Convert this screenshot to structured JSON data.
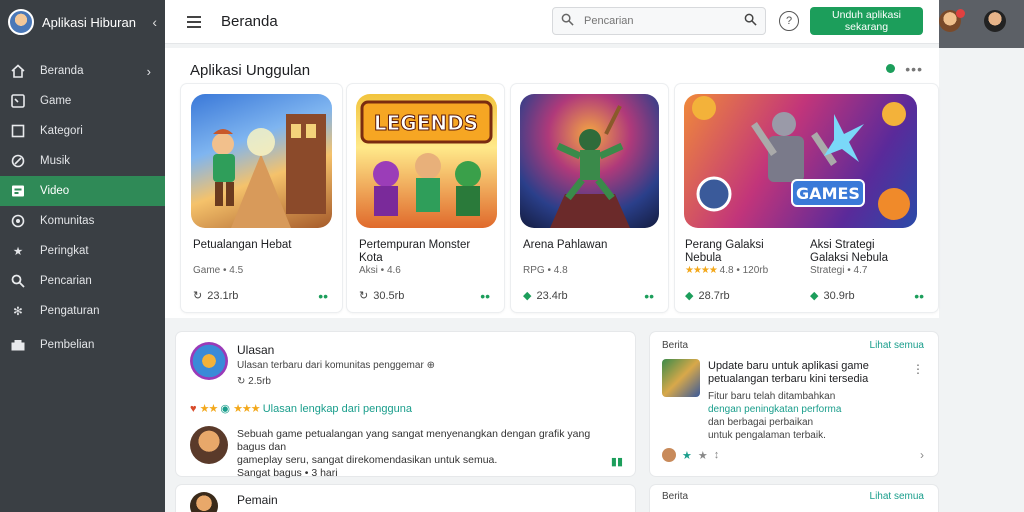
{
  "sidebar": {
    "title": "Aplikasi Hiburan",
    "items": [
      {
        "label": "Beranda",
        "icon": "home-icon"
      },
      {
        "label": "Game",
        "icon": "gamepad-icon"
      },
      {
        "label": "Kategori",
        "icon": "category-icon"
      },
      {
        "label": "Musik",
        "icon": "music-icon"
      },
      {
        "label": "Video",
        "icon": "video-icon"
      },
      {
        "label": "Komunitas",
        "icon": "community-icon"
      },
      {
        "label": "Peringkat",
        "icon": "star-icon"
      },
      {
        "label": "Pencarian",
        "icon": "search-icon"
      },
      {
        "label": "Pengaturan",
        "icon": "settings-icon"
      },
      {
        "label": "Pembelian",
        "icon": "cart-icon"
      }
    ]
  },
  "header": {
    "title": "Beranda",
    "search_placeholder": "Pencarian",
    "cta_label": "Unduh aplikasi sekarang"
  },
  "apps_section": {
    "title": "Aplikasi Unggulan",
    "cards": [
      {
        "title": "Petualangan Hebat",
        "meta": "Game • 4.5",
        "foot": "23.1rb"
      },
      {
        "title": "Pertempuran Monster Kota",
        "meta": "Aksi • 4.6",
        "foot": "30.5rb",
        "thumb_text": "LEGENDS"
      },
      {
        "title": "Arena Pahlawan",
        "meta": "RPG • 4.8",
        "foot": "23.4rb"
      },
      {
        "title": "Perang Galaksi Nebula",
        "meta": "4.8 • 120rb",
        "foot": "28.7rb"
      },
      {
        "title": "Aksi Strategi Galaksi Nebula",
        "meta": "Strategi • 4.7",
        "foot": "30.9rb",
        "thumb_text": "GAMES"
      }
    ]
  },
  "reviews": {
    "name": "Ulasan",
    "subtitle": "Ulasan terbaru dari komunitas penggemar",
    "count": "2.5rb",
    "tags": "Ulasan lengkap dari pengguna",
    "text_line1": "Sebuah game petualangan yang sangat menyenangkan dengan grafik yang bagus dan",
    "text_line2": "gameplay seru, sangat direkomendasikan untuk semua.",
    "text_line3": "Sangat bagus • 3 hari",
    "name2": "Pemain"
  },
  "news": {
    "label": "Berita",
    "link": "Lihat semua",
    "headline1": "Update baru untuk aplikasi game",
    "headline2": "petualangan terbaru kini tersedia",
    "line3": "Fitur baru telah ditambahkan",
    "line4": "dengan peningkatan performa",
    "line5": "dan berbagai perbaikan",
    "line6": "untuk pengalaman terbaik.",
    "label2": "Berita",
    "link2": "Lihat semua"
  }
}
